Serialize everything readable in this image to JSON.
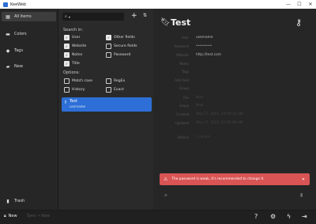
{
  "window": {
    "title": "KeeWeb",
    "minimize": "—",
    "maximize": "☐",
    "close": "✕"
  },
  "sidebar": {
    "all_items": "All items",
    "colors": "Colors",
    "tags": "Tags",
    "new": "New",
    "trash": "Trash"
  },
  "list": {
    "search_in_label": "Search in:",
    "options_label": "Options:",
    "checkboxes": {
      "user": "User",
      "other_fields": "Other fields",
      "website": "Website",
      "secure_fields": "Secure fields",
      "notes": "Notes",
      "password": "Password",
      "title": "Title",
      "match_case": "Match case",
      "regex": "RegEx",
      "history": "History",
      "exact": "Exact"
    },
    "entry": {
      "title": "Test",
      "subtitle": "username"
    }
  },
  "detail": {
    "title": "Test",
    "fields": [
      {
        "label": "User",
        "value": "username"
      },
      {
        "label": "Password",
        "value": "••••••••"
      },
      {
        "label": "Website",
        "value": "http://test.com"
      },
      {
        "label": "Notes",
        "value": ""
      },
      {
        "label": "Tags",
        "value": ""
      },
      {
        "label": "Add field",
        "value": ""
      },
      {
        "label": "Group",
        "value": ""
      },
      {
        "label": "File",
        "value": "New"
      },
      {
        "label": "Group",
        "value": "New"
      },
      {
        "label": "Created",
        "value": "May 17, 2021, 10:05:31 AM"
      },
      {
        "label": "Updated",
        "value": "May 17, 2021, 10:05:46 AM"
      },
      {
        "label": "",
        "value": ""
      },
      {
        "label": "History",
        "value": "1 record"
      }
    ],
    "warning": "The password is weak, it's recommended to change it."
  },
  "footer": {
    "new_label": "New",
    "sync_label": "Sync • New"
  }
}
